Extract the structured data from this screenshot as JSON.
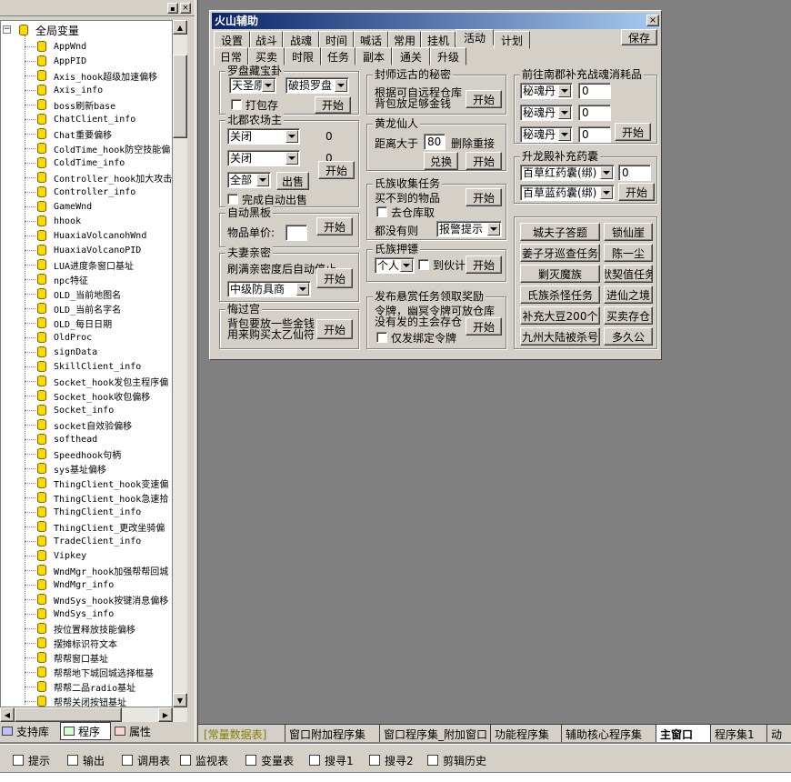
{
  "tree": {
    "root": "全局变量",
    "items": [
      "AppWnd",
      "AppPID",
      "Axis_hook超级加速偏移",
      "Axis_info",
      "boss刷新base",
      "ChatClient_info",
      "Chat重要偏移",
      "ColdTime_hook防空技能偏",
      "ColdTime_info",
      "Controller_hook加大攻击",
      "Controller_info",
      "GameWnd",
      "hhook",
      "HuaxiaVolcanohWnd",
      "HuaxiaVolcanoPID",
      "LUA进度条窗口基址",
      "npc特征",
      "OLD_当前地图名",
      "OLD_当前名字名",
      "OLD_每日日期",
      "OldProc",
      "signData",
      "SkillClient_info",
      "Socket_hook发包主程序偏",
      "Socket_hook收包偏移",
      "Socket_info",
      "socket自效验偏移",
      "softhead",
      "Speedhook句柄",
      "sys基址偏移",
      "ThingClient_hook变速偏",
      "ThingClient_hook急速拾",
      "ThingClient_info",
      "ThingClient_更改坐骑偏",
      "TradeClient_info",
      "Vipkey",
      "WndMgr_hook加强帮帮回城",
      "WndMgr_info",
      "WndSys_hook按键消息偏移",
      "WndSys_info",
      "按位置释放技能偏移",
      "摆摊标识符文本",
      "帮帮窗口基址",
      "帮帮地下城回城选择框基",
      "帮帮二品radio基址",
      "帮帮关闭按钮基址"
    ]
  },
  "left_tabs": [
    "支持库",
    "程序",
    "属性"
  ],
  "window": {
    "title": "火山辅助",
    "close": "×",
    "tabs_row1": [
      "设置",
      "战斗",
      "战魂",
      "时间",
      "喊话",
      "常用",
      "挂机",
      "活动",
      "计划"
    ],
    "tabs_row2": [
      "日常",
      "买卖",
      "时限",
      "任务",
      "副本",
      "通关",
      "升级"
    ],
    "save": "保存",
    "g1": {
      "title": "罗盘藏宝卦",
      "sel1": "天圣原",
      "sel2": "破损罗盘",
      "chk": "打包存",
      "btn": "开始"
    },
    "g2": {
      "title": "北郡农场主",
      "sel1": "关闭",
      "val1": "0",
      "sel2": "关闭",
      "val2": "0",
      "sel3": "全部",
      "btn_sell": "出售",
      "btn": "开始",
      "chk": "完成自动出售"
    },
    "g3": {
      "title": "自动黑板",
      "label": "物品单价:",
      "btn": "开始"
    },
    "g4": {
      "title": "夫妻亲密",
      "label": "刷满亲密度后自动停止",
      "sel": "中级防具商",
      "btn": "开始"
    },
    "g5": {
      "title": "悔过宫",
      "line1": "背包要放一些金钱",
      "line2": "用来购买太乙仙符",
      "btn": "开始"
    },
    "g6": {
      "title": "封师远古的秘密",
      "line1": "根据可自远程仓库",
      "line2": "背包放足够金钱",
      "btn": "开始"
    },
    "g7": {
      "title": "黄龙仙人",
      "label": "距离大于",
      "val": "80",
      "label2": "删除重接",
      "btn1": "兑换",
      "btn2": "开始"
    },
    "g8": {
      "title": "氏族收集任务",
      "line1": "买不到的物品",
      "chk": "去仓库取",
      "line2": "都没有则",
      "sel": "报警提示",
      "btn": "开始"
    },
    "g9": {
      "title": "氏族押镖",
      "sel": "个人",
      "chk": "到伙计",
      "btn": "开始"
    },
    "g10": {
      "title": "发布悬赏任务领取奖励",
      "line1": "令牌，幽冥令牌可放仓库",
      "line2": "没有发的主会存仓",
      "chk": "仅发绑定令牌",
      "btn": "开始"
    },
    "g11": {
      "title": "前往南郡补充战魂消耗品",
      "rows": [
        {
          "sel": "秘魂丹",
          "val": "0"
        },
        {
          "sel": "秘魂丹",
          "val": "0"
        },
        {
          "sel": "秘魂丹",
          "val": "0"
        }
      ],
      "btn": "开始"
    },
    "g12": {
      "title": "升龙殿补充药囊",
      "rows": [
        {
          "sel": "百草红药囊(绑)",
          "val": "0"
        },
        {
          "sel": "百草蓝药囊(绑)"
        }
      ],
      "btn": "开始"
    },
    "quick": [
      [
        "城夫子答题",
        "锁仙崖"
      ],
      [
        "姜子牙巡查任务",
        "陈一尘"
      ],
      [
        "剿灭魔族",
        "默契值任务"
      ],
      [
        "氏族杀怪任务",
        "进仙之境"
      ],
      [
        "补充大豆200个",
        "买卖存仓"
      ],
      [
        "九州大陆被杀号",
        "多久公"
      ]
    ]
  },
  "bottom_tabs": [
    "[常量数据表]",
    "窗口附加程序集",
    "窗口程序集_附加窗口",
    "功能程序集",
    "辅助核心程序集",
    "主窗口",
    "程序集1",
    "动"
  ],
  "toolbar": [
    "提示",
    "输出",
    "调用表",
    "监视表",
    "变量表",
    "搜寻1",
    "搜寻2",
    "剪辑历史"
  ]
}
